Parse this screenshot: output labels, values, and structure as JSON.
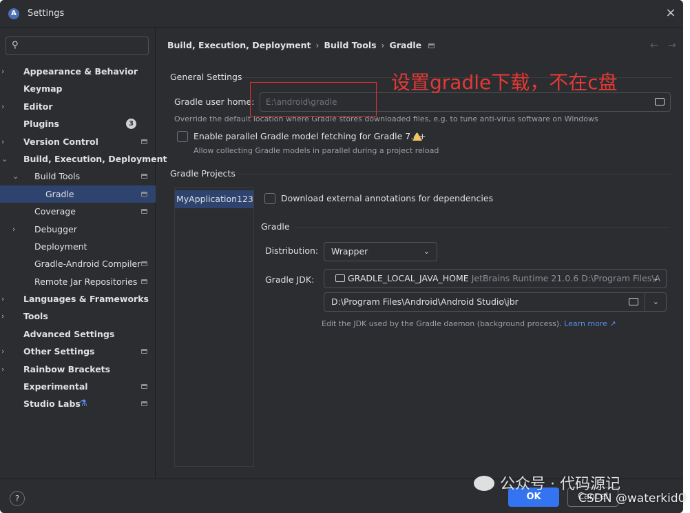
{
  "window": {
    "title": "Settings",
    "close_glyph": "×"
  },
  "search": {
    "value": "",
    "placeholder": ""
  },
  "sidebar": {
    "items": [
      {
        "label": "Appearance & Behavior",
        "bold": true,
        "level": 0,
        "expand": "›",
        "pin": false
      },
      {
        "label": "Keymap",
        "bold": true,
        "level": 0,
        "expand": "",
        "pin": false
      },
      {
        "label": "Editor",
        "bold": true,
        "level": 0,
        "expand": "›",
        "pin": false
      },
      {
        "label": "Plugins",
        "bold": true,
        "level": 0,
        "expand": "",
        "pin": false,
        "badge": "3"
      },
      {
        "label": "Version Control",
        "bold": true,
        "level": 0,
        "expand": "›",
        "pin": true
      },
      {
        "label": "Build, Execution, Deployment",
        "bold": true,
        "level": 0,
        "expand": "⌄",
        "pin": false
      },
      {
        "label": "Build Tools",
        "bold": false,
        "level": 1,
        "expand": "⌄",
        "pin": true
      },
      {
        "label": "Gradle",
        "bold": false,
        "level": 2,
        "expand": "",
        "pin": true,
        "selected": true
      },
      {
        "label": "Coverage",
        "bold": false,
        "level": 1,
        "expand": "",
        "pin": true
      },
      {
        "label": "Debugger",
        "bold": false,
        "level": 1,
        "expand": "›",
        "pin": false
      },
      {
        "label": "Deployment",
        "bold": false,
        "level": 1,
        "expand": "",
        "pin": false
      },
      {
        "label": "Gradle-Android Compiler",
        "bold": false,
        "level": 1,
        "expand": "",
        "pin": true
      },
      {
        "label": "Remote Jar Repositories",
        "bold": false,
        "level": 1,
        "expand": "",
        "pin": true
      },
      {
        "label": "Languages & Frameworks",
        "bold": true,
        "level": 0,
        "expand": "›",
        "pin": false
      },
      {
        "label": "Tools",
        "bold": true,
        "level": 0,
        "expand": "›",
        "pin": false
      },
      {
        "label": "Advanced Settings",
        "bold": true,
        "level": 0,
        "expand": "",
        "pin": false
      },
      {
        "label": "Other Settings",
        "bold": true,
        "level": 0,
        "expand": "›",
        "pin": true
      },
      {
        "label": "Rainbow Brackets",
        "bold": true,
        "level": 0,
        "expand": "›",
        "pin": false
      },
      {
        "label": "Experimental",
        "bold": true,
        "level": 0,
        "expand": "",
        "pin": true
      },
      {
        "label": "Studio Labs",
        "bold": true,
        "level": 0,
        "expand": "",
        "pin": true,
        "icon": "flask-icon"
      }
    ]
  },
  "breadcrumb": {
    "items": [
      "Build, Execution, Deployment",
      "Build Tools",
      "Gradle"
    ],
    "separator": "›",
    "back": "←",
    "forward": "→"
  },
  "general": {
    "title": "General Settings",
    "user_home_label": "Gradle user home:",
    "user_home_value": "E:\\android\\gradle",
    "user_home_hint": "Override the default location where Gradle stores downloaded files, e.g. to tune anti-virus software on Windows",
    "parallel_label": "Enable parallel Gradle model fetching for Gradle 7.4+",
    "parallel_hint": "Allow collecting Gradle models in parallel during a project reload",
    "parallel_checked": false
  },
  "projects": {
    "title": "Gradle Projects",
    "items": [
      "MyApplication123"
    ],
    "download_annotations_label": "Download external annotations for dependencies",
    "download_annotations_checked": false
  },
  "gradle": {
    "title": "Gradle",
    "distribution_label": "Distribution:",
    "distribution_value": "Wrapper",
    "jdk_label": "Gradle JDK:",
    "jdk_name": "GRADLE_LOCAL_JAVA_HOME",
    "jdk_detail": "JetBrains Runtime 21.0.6 D:\\Program Files\\A",
    "jdk_path": "D:\\Program Files\\Android\\Android Studio\\jbr",
    "jdk_hint": "Edit the JDK used by the Gradle daemon (background process).",
    "learn_more": "Learn more ↗"
  },
  "footer": {
    "help": "?",
    "ok": "OK",
    "cancel": "Cancel"
  },
  "annotation": {
    "text": "设置gradle下载，不在c盘"
  },
  "watermarks": {
    "wechat": "公众号 · 代码源记",
    "csdn": "CSDN @waterkid0"
  },
  "colors": {
    "accent": "#3574f0",
    "selection": "#2e436e",
    "background": "#2b2d30",
    "annotation": "#e53935",
    "warning": "#f2c55c"
  }
}
